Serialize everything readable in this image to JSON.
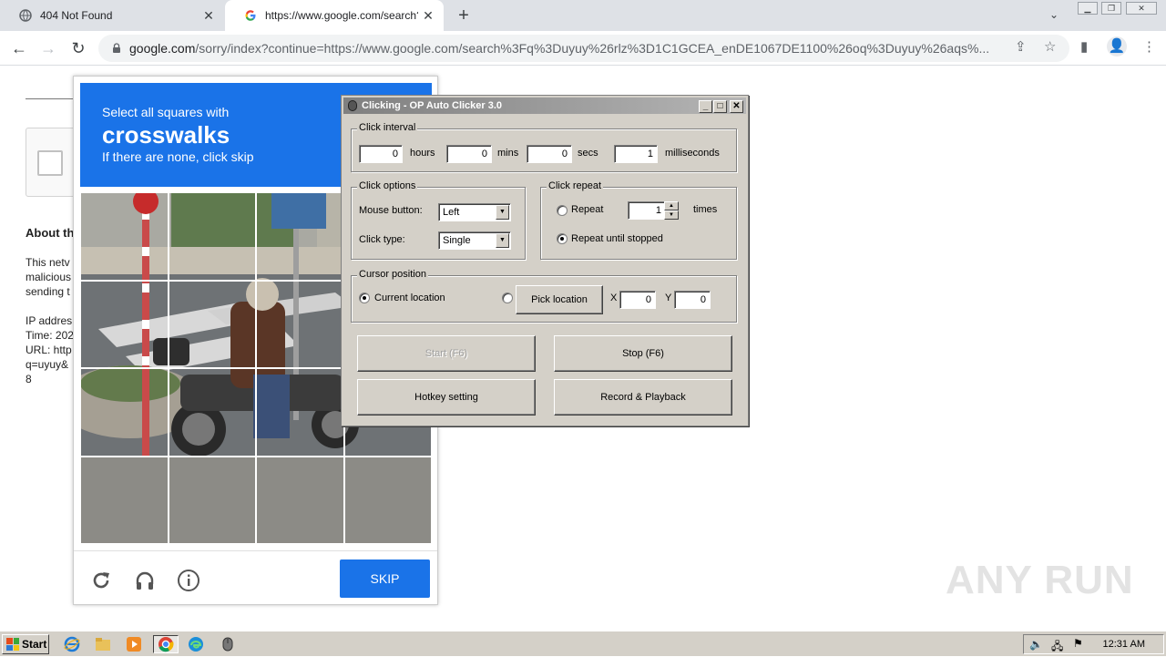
{
  "browser": {
    "tabs": [
      {
        "title": "404 Not Found",
        "active": false
      },
      {
        "title": "https://www.google.com/search?q=",
        "active": true
      }
    ],
    "new_tab": "+",
    "address": {
      "host": "google.com",
      "path": "/sorry/index?continue=https://www.google.com/search%3Fq%3Duyuy%26rlz%3D1C1GCEA_enDE1067DE1100%26oq%3Duyuy%26aqs%..."
    }
  },
  "page": {
    "about_heading": "About th",
    "paragraph1": [
      "This netv",
      "malicious",
      "sending t"
    ],
    "paragraph2": [
      "IP addres",
      "Time: 202",
      "URL: http",
      "q=uyuy&",
      "8"
    ]
  },
  "captcha": {
    "instruction": "Select all squares with",
    "target": "crosswalks",
    "hint": "If there are none, click skip",
    "skip_label": "SKIP",
    "grid_size": 4
  },
  "clicker": {
    "title": "Clicking - OP Auto Clicker 3.0",
    "interval": {
      "legend": "Click interval",
      "hours": "0",
      "hours_label": "hours",
      "mins": "0",
      "mins_label": "mins",
      "secs": "0",
      "secs_label": "secs",
      "ms": "1",
      "ms_label": "milliseconds"
    },
    "options": {
      "legend": "Click options",
      "mouse_label": "Mouse button:",
      "mouse_value": "Left",
      "type_label": "Click type:",
      "type_value": "Single"
    },
    "repeat": {
      "legend": "Click repeat",
      "repeat_label": "Repeat",
      "repeat_count": "1",
      "times_label": "times",
      "until_label": "Repeat until stopped"
    },
    "cursor": {
      "legend": "Cursor position",
      "current_label": "Current location",
      "pick_label": "Pick location",
      "x_label": "X",
      "x_value": "0",
      "y_label": "Y",
      "y_value": "0"
    },
    "buttons": {
      "start": "Start (F6)",
      "stop": "Stop (F6)",
      "hotkey": "Hotkey setting",
      "record": "Record & Playback"
    }
  },
  "watermark": "ANY RUN",
  "taskbar": {
    "start_label": "Start",
    "clock": "12:31 AM"
  }
}
